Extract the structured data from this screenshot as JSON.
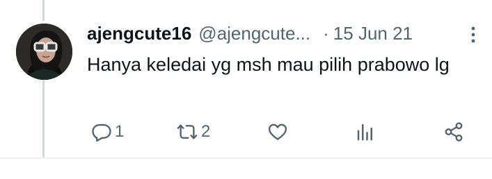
{
  "tweet": {
    "display_name": "ajengcute16",
    "handle": "@ajengcute...",
    "separator": "·",
    "date": "15 Jun 21",
    "text": "Hanya keledai yg msh mau pilih prabowo lg"
  },
  "actions": {
    "replies": "1",
    "retweets": "2"
  },
  "icons": {
    "reply": "reply-icon",
    "retweet": "retweet-icon",
    "like": "heart-icon",
    "views": "bar-chart-icon",
    "share": "share-icon",
    "more": "more-vertical-icon"
  },
  "colors": {
    "text": "#0f1419",
    "secondary": "#536471",
    "thread_line": "#cfd9de",
    "divider": "#eff3f4"
  }
}
